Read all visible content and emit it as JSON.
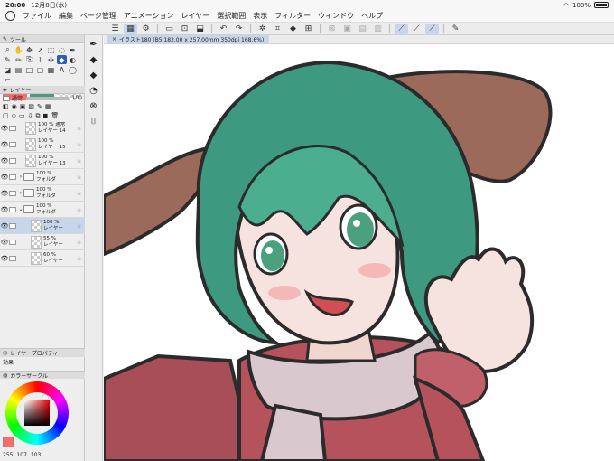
{
  "status": {
    "time": "20:00",
    "date": "12月8日(水)",
    "battery": "100%"
  },
  "menu": [
    "ファイル",
    "編集",
    "ページ管理",
    "アニメーション",
    "レイヤー",
    "選択範囲",
    "表示",
    "フィルター",
    "ウィンドウ",
    "ヘルプ"
  ],
  "tool_panel": {
    "title": "ツール"
  },
  "layer_panel": {
    "title": "レイヤー",
    "blend_mode": "通常",
    "opacity": "100",
    "layers": [
      {
        "pct": "100 %",
        "name": "レイヤー 14",
        "kind": "layer",
        "indent": 1,
        "extra": "通常"
      },
      {
        "pct": "100 %",
        "name": "レイヤー 15",
        "kind": "layer",
        "indent": 1,
        "extra": ""
      },
      {
        "pct": "100 %",
        "name": "レイヤー 13",
        "kind": "layer",
        "indent": 1,
        "extra": ""
      },
      {
        "pct": "100 %",
        "name": "フォルダ",
        "kind": "folder",
        "indent": 1,
        "extra": ""
      },
      {
        "pct": "100 %",
        "name": "フォルダ",
        "kind": "folder",
        "indent": 1,
        "extra": ""
      },
      {
        "pct": "100 %",
        "name": "フォルダ",
        "kind": "folder",
        "indent": 0,
        "extra": ""
      },
      {
        "pct": "100 %",
        "name": "レイヤー",
        "kind": "layer",
        "indent": 2,
        "extra": "",
        "selected": true
      },
      {
        "pct": "55 %",
        "name": "レイヤー",
        "kind": "layer",
        "indent": 2,
        "extra": ""
      },
      {
        "pct": "60 %",
        "name": "レイヤー",
        "kind": "layer",
        "indent": 2,
        "extra": ""
      }
    ]
  },
  "layer_property": {
    "title": "レイヤープロパティ",
    "effect_label": "効果"
  },
  "color_panel": {
    "title": "カラーサークル",
    "r": "255",
    "g": "107",
    "b": "103",
    "current": "#ff6b67"
  },
  "canvas_tab": {
    "label": "イラスト180 (B5 182.00 x 257.00mm 350dpi 168.6%)"
  },
  "colors": {
    "accent": "#2f5fb5",
    "selection": "#c7d6ea",
    "hair": "#3c9c82",
    "ear": "#9c6a5a"
  }
}
